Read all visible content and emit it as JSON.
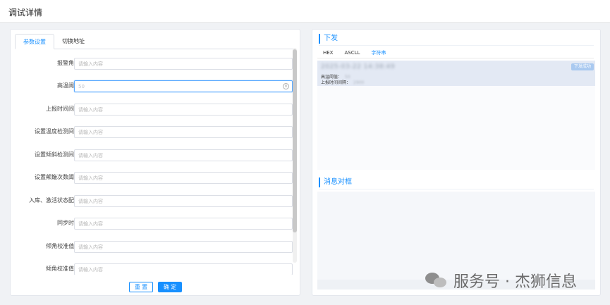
{
  "header": {
    "title": "调试详情"
  },
  "left": {
    "tabs": [
      {
        "label": "参数设置"
      },
      {
        "label": "切换地址"
      }
    ],
    "fields": [
      {
        "label": "报警角度",
        "value": "",
        "placeholder": "请输入内容"
      },
      {
        "label": "高温阈值",
        "value": "50",
        "placeholder": "请输入内容"
      },
      {
        "label": "上报时间间隔",
        "value": "",
        "placeholder": "请输入内容"
      },
      {
        "label": "设置温度检测间隔",
        "value": "",
        "placeholder": "请输入内容"
      },
      {
        "label": "设置倾斜检测间隔",
        "value": "",
        "placeholder": "请输入内容"
      },
      {
        "label": "设置颠簸次数阈值",
        "value": "",
        "placeholder": "请输入内容"
      },
      {
        "label": "入库、激活状态配置",
        "value": "",
        "placeholder": "请输入内容"
      },
      {
        "label": "同步时间",
        "value": "",
        "placeholder": "请输入内容"
      },
      {
        "label": "倾角校准值 K",
        "value": "",
        "placeholder": "请输入内容"
      },
      {
        "label": "倾角校准值 B",
        "value": "",
        "placeholder": "请输入内容"
      }
    ],
    "buttons": {
      "reset": "重 置",
      "ok": "确 定"
    }
  },
  "right": {
    "send_title": "下发",
    "subtabs": [
      {
        "label": "HEX"
      },
      {
        "label": "ASCLL"
      },
      {
        "label": "字符串"
      }
    ],
    "send_item": {
      "time": "2025-03-22 14:38:49",
      "status": "下发成功",
      "line1_key": "高温阈值：",
      "line1_val": "50",
      "line2_key": "上报时间间隔：",
      "line2_val": "2900"
    },
    "msg_title": "消息对框"
  },
  "watermark": {
    "text": "服务号 · 杰狮信息"
  },
  "colors": {
    "accent": "#1890ff",
    "status_badge": "#a9c9f0",
    "item_bg": "#e3e9f4"
  }
}
